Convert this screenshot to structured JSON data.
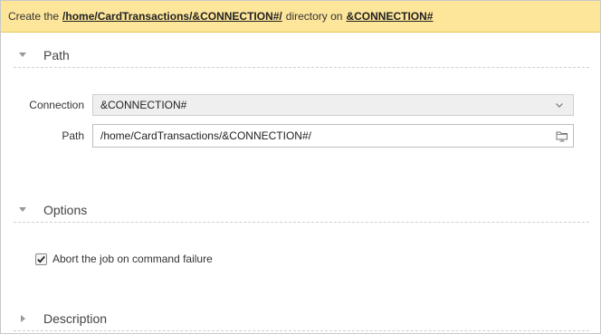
{
  "banner": {
    "prefix": "Create the",
    "path": "/home/CardTransactions/&CONNECTION#/",
    "middle": "directory on",
    "connection": "&CONNECTION#"
  },
  "sections": {
    "path": {
      "title": "Path",
      "expanded": true
    },
    "options": {
      "title": "Options",
      "expanded": true
    },
    "description": {
      "title": "Description",
      "expanded": false
    }
  },
  "form": {
    "connection_label": "Connection",
    "connection_value": "&CONNECTION#",
    "path_label": "Path",
    "path_value": "/home/CardTransactions/&CONNECTION#/"
  },
  "options": {
    "abort_label": "Abort the job on command failure",
    "abort_checked": true
  },
  "icons": {
    "collapse": "caret-down-icon",
    "expand": "caret-right-icon",
    "dropdown": "chevron-down-icon",
    "browse": "folder-browse-icon",
    "check": "checkmark-icon"
  },
  "colors": {
    "banner_bg": "#fde59a",
    "border": "#c8c8c8"
  }
}
